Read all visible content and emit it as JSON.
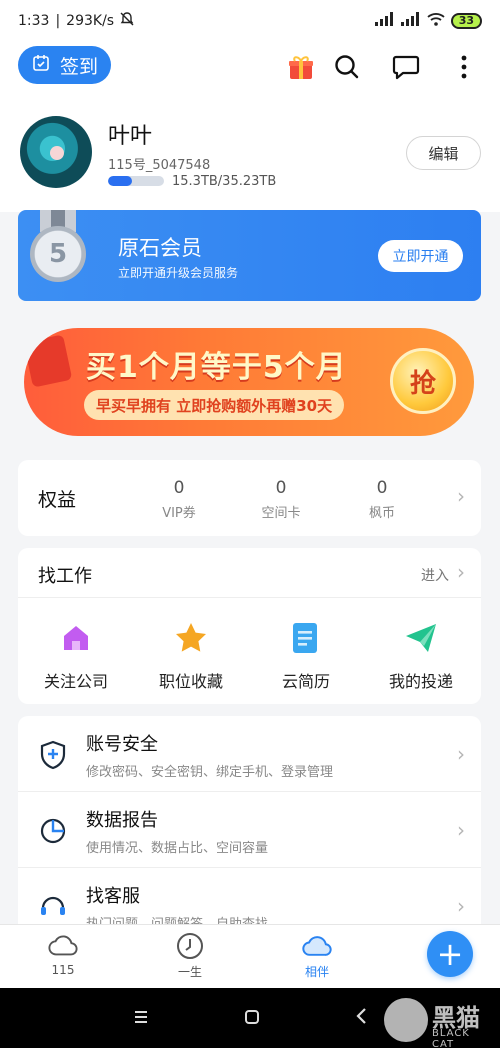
{
  "status": {
    "time": "1:33",
    "speed": "293K/s",
    "battery": "33"
  },
  "topbar": {
    "checkin_label": "签到"
  },
  "profile": {
    "name": "叶叶",
    "id": "115号_5047548",
    "storage": "15.3TB/35.23TB",
    "storage_used_fraction": 0.434,
    "edit_label": "编辑"
  },
  "member": {
    "title": "原石会员",
    "subtitle": "立即开通升级会员服务",
    "button": "立即开通",
    "medal_number": "5"
  },
  "promo": {
    "main": "买1个月等于5个月",
    "sub": "早买早拥有 立即抢购额外再赠30天",
    "grab": "抢"
  },
  "rights": {
    "title": "权益",
    "items": [
      {
        "value": "0",
        "label": "VIP券"
      },
      {
        "value": "0",
        "label": "空间卡"
      },
      {
        "value": "0",
        "label": "枫币"
      }
    ]
  },
  "jobs": {
    "title": "找工作",
    "enter": "进入",
    "items": [
      {
        "label": "关注公司",
        "icon": "house-icon",
        "color": "#c25cf0"
      },
      {
        "label": "职位收藏",
        "icon": "star-icon",
        "color": "#f5a623"
      },
      {
        "label": "云简历",
        "icon": "document-icon",
        "color": "#3aa7f0"
      },
      {
        "label": "我的投递",
        "icon": "paper-plane-icon",
        "color": "#22c38e"
      }
    ]
  },
  "settings": [
    {
      "title": "账号安全",
      "subtitle": "修改密码、安全密钥、绑定手机、登录管理",
      "icon": "shield-icon"
    },
    {
      "title": "数据报告",
      "subtitle": "使用情况、数据占比、空间容量",
      "icon": "pie-chart-icon"
    },
    {
      "title": "找客服",
      "subtitle": "热门问题、问题解答、自助查找",
      "icon": "headset-icon"
    }
  ],
  "tabs": [
    {
      "label": "115",
      "icon": "cloud-icon",
      "active": false
    },
    {
      "label": "一生",
      "icon": "clock-icon",
      "active": false
    },
    {
      "label": "相伴",
      "icon": "cloud-filled-icon",
      "active": true
    }
  ],
  "watermark": {
    "main": "黑猫",
    "sub": "BLACK CAT"
  },
  "colors": {
    "accent": "#2a83f1",
    "promo": "#ff7a36"
  }
}
